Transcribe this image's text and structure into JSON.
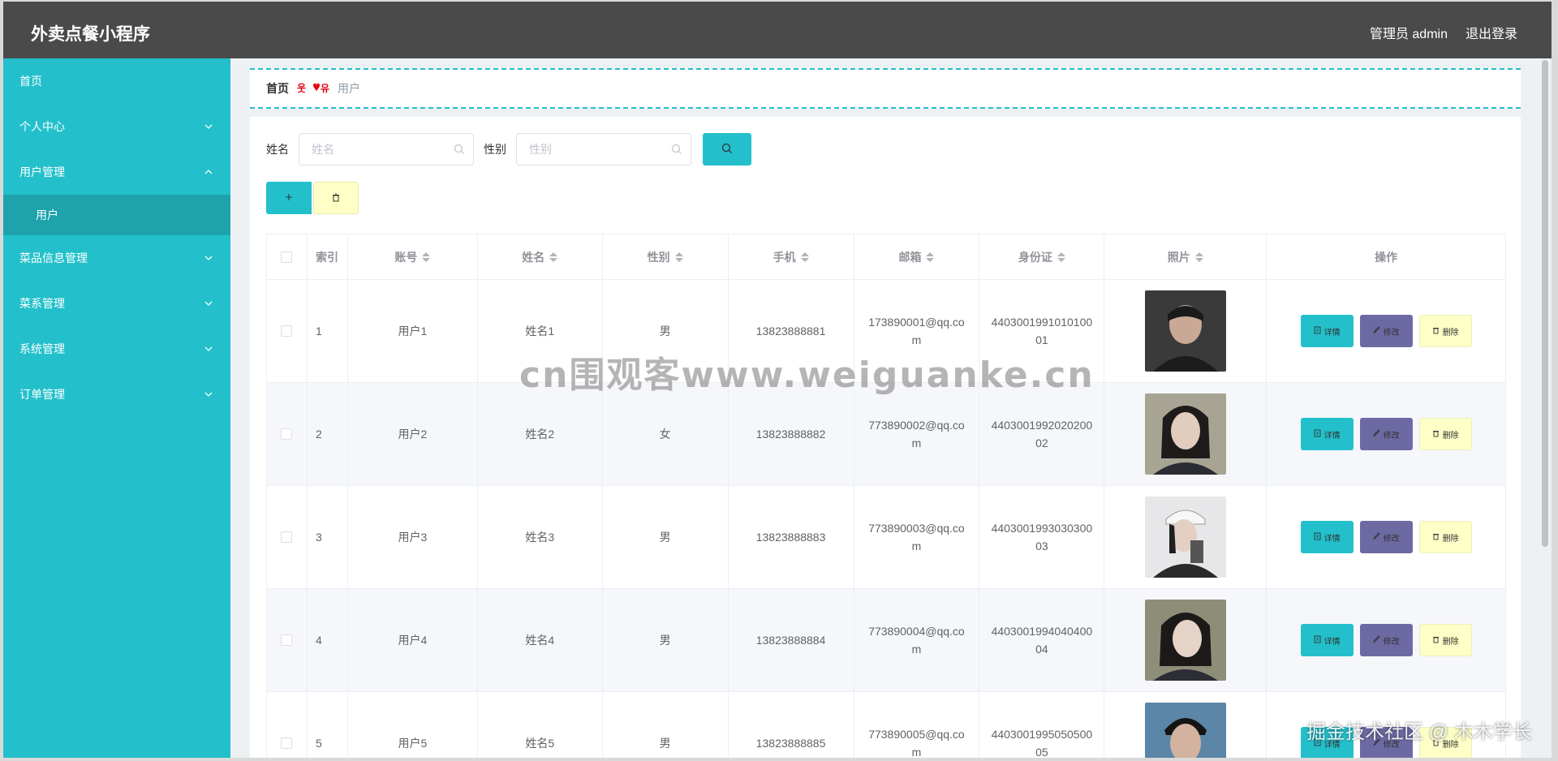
{
  "header": {
    "title": "外卖点餐小程序",
    "admin_label": "管理员 admin",
    "logout_label": "退出登录"
  },
  "sidebar": {
    "items": [
      {
        "label": "首页"
      },
      {
        "label": "个人中心"
      },
      {
        "label": "用户管理"
      },
      {
        "label": "用户"
      },
      {
        "label": "菜品信息管理"
      },
      {
        "label": "菜系管理"
      },
      {
        "label": "系统管理"
      },
      {
        "label": "订单管理"
      }
    ]
  },
  "breadcrumb": {
    "home": "首页",
    "separator": "😍",
    "current": "用户"
  },
  "search": {
    "name_label": "姓名",
    "name_placeholder": "姓名",
    "sex_label": "性别",
    "sex_placeholder": "性别"
  },
  "table": {
    "headers": {
      "index": "索引",
      "account": "账号",
      "name": "姓名",
      "sex": "性别",
      "phone": "手机",
      "email": "邮箱",
      "idcard": "身份证",
      "photo": "照片",
      "operation": "操作"
    },
    "rows": [
      {
        "index": "1",
        "account": "用户1",
        "name": "姓名1",
        "sex": "男",
        "phone": "13823888881",
        "email": "173890001@qq.com",
        "idcard": "440300199101010001"
      },
      {
        "index": "2",
        "account": "用户2",
        "name": "姓名2",
        "sex": "女",
        "phone": "13823888882",
        "email": "773890002@qq.com",
        "idcard": "440300199202020002"
      },
      {
        "index": "3",
        "account": "用户3",
        "name": "姓名3",
        "sex": "男",
        "phone": "13823888883",
        "email": "773890003@qq.com",
        "idcard": "440300199303030003"
      },
      {
        "index": "4",
        "account": "用户4",
        "name": "姓名4",
        "sex": "男",
        "phone": "13823888884",
        "email": "773890004@qq.com",
        "idcard": "440300199404040004"
      },
      {
        "index": "5",
        "account": "用户5",
        "name": "姓名5",
        "sex": "男",
        "phone": "13823888885",
        "email": "773890005@qq.com",
        "idcard": "440300199505050005"
      }
    ],
    "op_labels": {
      "detail": "详情",
      "edit": "修改",
      "delete": "删除"
    }
  },
  "watermarks": {
    "center": "cn围观客www.weiguanke.cn",
    "corner": "掘金技术社区 @ 木木学长"
  },
  "colors": {
    "accent": "#23c0cb",
    "header_bg": "#4a4a4a",
    "edit_btn": "#6d6aa3",
    "delete_btn": "#fdffc6"
  }
}
